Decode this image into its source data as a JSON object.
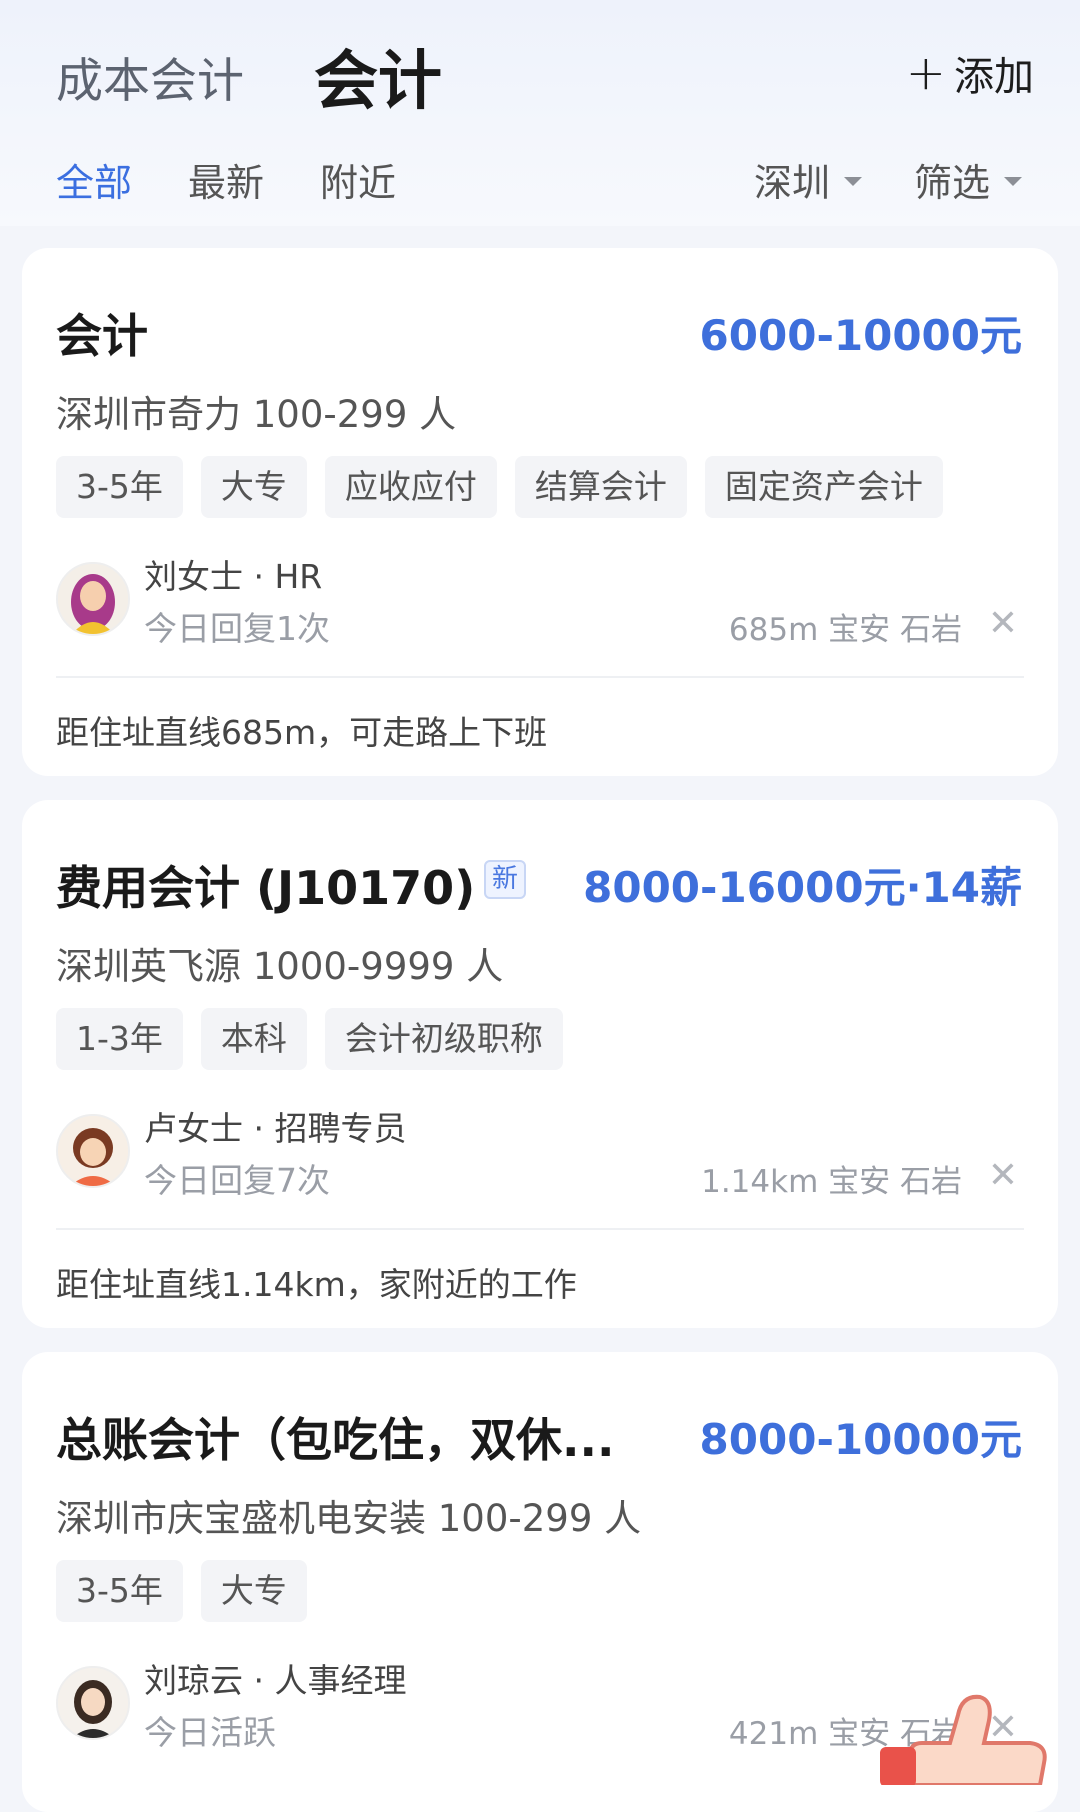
{
  "header": {
    "prev_category": "成本会计",
    "current_category": "会计",
    "add_label": "添加"
  },
  "tabs": {
    "all": "全部",
    "latest": "最新",
    "nearby": "附近",
    "city": "深圳",
    "filter": "筛选"
  },
  "colors": {
    "accent": "#3e6fdb",
    "tab_active": "#3b6fe0"
  },
  "jobs": [
    {
      "title": "会计",
      "salary": "6000-10000元",
      "company": "深圳市奇力 100-299 人",
      "tags": [
        "3-5年",
        "大专",
        "应收应付",
        "结算会计",
        "固定资产会计"
      ],
      "recruiter": "刘女士 · HR",
      "reply": "今日回复1次",
      "distance": "685m 宝安 石岩",
      "note": "距住址直线685m，可走路上下班"
    },
    {
      "title": "费用会计 (J10170)",
      "badge": "新",
      "salary": "8000-16000元·14薪",
      "company": "深圳英飞源 1000-9999 人",
      "tags": [
        "1-3年",
        "本科",
        "会计初级职称"
      ],
      "recruiter": "卢女士 · 招聘专员",
      "reply": "今日回复7次",
      "distance": "1.14km 宝安 石岩",
      "note": "距住址直线1.14km，家附近的工作"
    },
    {
      "title": "总账会计（包吃住，双休...",
      "salary": "8000-10000元",
      "company": "深圳市庆宝盛机电安装 100-299 人",
      "tags": [
        "3-5年",
        "大专"
      ],
      "recruiter": "刘琼云 · 人事经理",
      "reply": "今日活跃",
      "distance": "421m 宝安 石岩"
    }
  ]
}
